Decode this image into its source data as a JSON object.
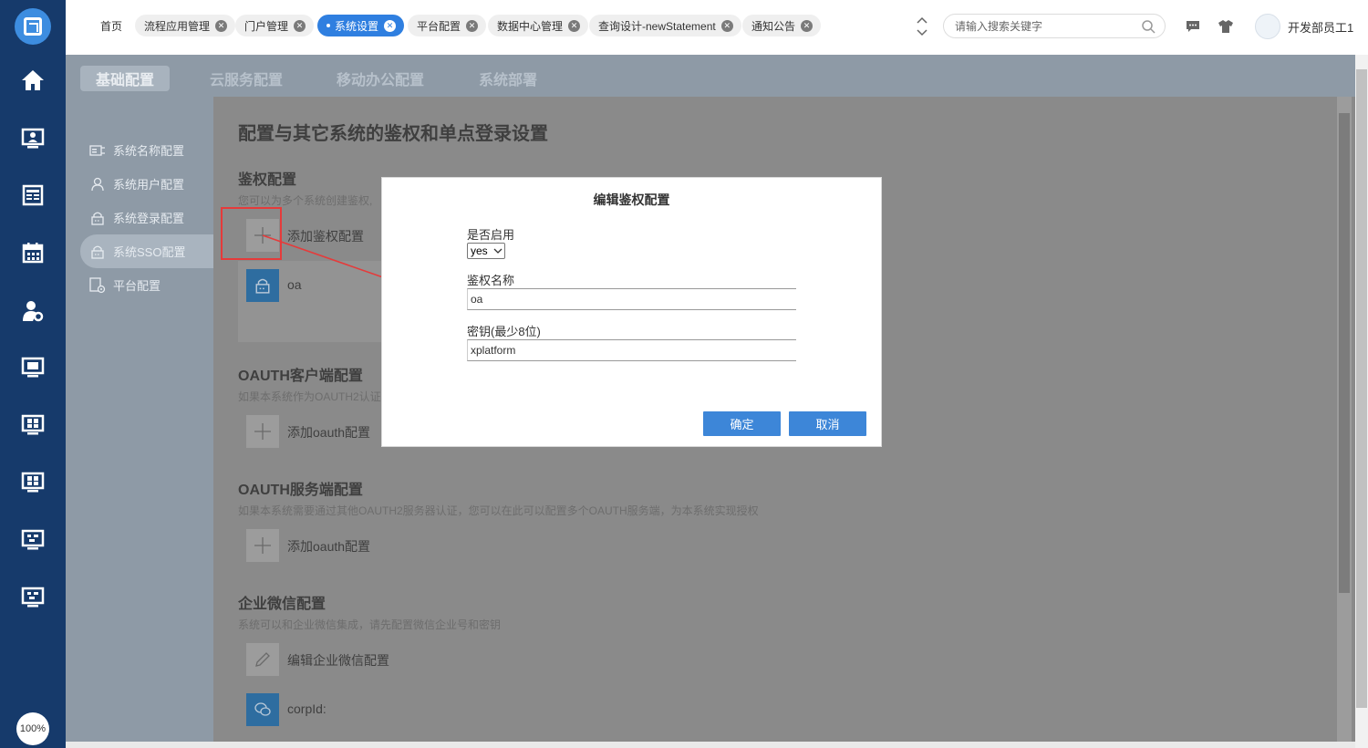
{
  "sidebar": {
    "zoom_label": "100%",
    "icons": [
      "home-icon",
      "monitor-user-icon",
      "newspaper-icon",
      "calendar-icon",
      "user-settings-icon",
      "monitor-app-icon",
      "monitor-grid-icon",
      "monitor-grid-icon",
      "monitor-flow-icon",
      "monitor-flow-icon"
    ]
  },
  "tabs": [
    {
      "label": "首页",
      "closable": false,
      "active": false
    },
    {
      "label": "流程应用管理",
      "closable": true,
      "active": false
    },
    {
      "label": "门户管理",
      "closable": true,
      "active": false
    },
    {
      "label": "系统设置",
      "closable": true,
      "active": true
    },
    {
      "label": "平台配置",
      "closable": true,
      "active": false
    },
    {
      "label": "数据中心管理",
      "closable": true,
      "active": false
    },
    {
      "label": "查询设计-newStatement",
      "closable": true,
      "active": false
    },
    {
      "label": "通知公告",
      "closable": true,
      "active": false
    }
  ],
  "search": {
    "placeholder": "请输入搜索关键字"
  },
  "user": {
    "name": "开发部员工1"
  },
  "subtabs": [
    "基础配置",
    "云服务配置",
    "移动办公配置",
    "系统部署"
  ],
  "menu": [
    {
      "label": "系统名称配置",
      "icon": "id-card-icon",
      "active": false
    },
    {
      "label": "系统用户配置",
      "icon": "user-icon",
      "active": false
    },
    {
      "label": "系统登录配置",
      "icon": "lock-icon",
      "active": false
    },
    {
      "label": "系统SSO配置",
      "icon": "lock-icon",
      "active": true
    },
    {
      "label": "平台配置",
      "icon": "document-gear-icon",
      "active": false
    }
  ],
  "page": {
    "title": "配置与其它系统的鉴权和单点登录设置",
    "auth": {
      "heading": "鉴权配置",
      "desc": "您可以为多个系统创建鉴权,",
      "add_label": "添加鉴权配置",
      "item_label": "oa"
    },
    "oauth_client": {
      "heading": "OAUTH客户端配置",
      "desc": "如果本系统作为OAUTH2认证",
      "add_label": "添加oauth配置"
    },
    "oauth_server": {
      "heading": "OAUTH服务端配置",
      "desc": "如果本系统需要通过其他OAUTH2服务器认证，您可以在此可以配置多个OAUTH服务端，为本系统实现授权",
      "add_label": "添加oauth配置"
    },
    "wechat": {
      "heading": "企业微信配置",
      "desc": "系统可以和企业微信集成，请先配置微信企业号和密钥",
      "edit_label": "编辑企业微信配置",
      "corp_label": "corpId:"
    }
  },
  "dialog": {
    "title": "编辑鉴权配置",
    "enabled_label": "是否启用",
    "enabled_value": "yes",
    "name_label": "鉴权名称",
    "name_value": "oa",
    "secret_label": "密钥(最少8位)",
    "secret_value": "xplatform",
    "ok_label": "确定",
    "cancel_label": "取消"
  },
  "colors": {
    "sidebar": "#163a6b",
    "accent": "#2f7fe0",
    "button": "#3d86d8",
    "annotation": "#e53b3b"
  }
}
